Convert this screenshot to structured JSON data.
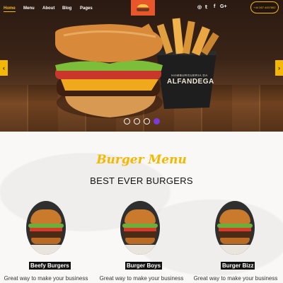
{
  "nav": {
    "items": [
      {
        "label": "Home",
        "active": true
      },
      {
        "label": "Menu",
        "active": false
      },
      {
        "label": "About",
        "active": false
      },
      {
        "label": "Blog",
        "active": false
      },
      {
        "label": "Pages",
        "active": false
      }
    ],
    "social": [
      "instagram-icon",
      "twitter-icon",
      "facebook-icon",
      "google-plus-icon"
    ],
    "social_glyphs": [
      "◎",
      "𝕥",
      "f",
      "G+"
    ],
    "phone": "+44 067 4457882"
  },
  "hero": {
    "cup_text": "HAMBURGUERIA DA",
    "cup_brand": "ALFANDEGA",
    "prev_glyph": "‹",
    "next_glyph": "›",
    "slide_count": 4,
    "active_slide": 4
  },
  "menu": {
    "script_title": "Burger Menu",
    "title": "BEST EVER BURGERS",
    "cards": [
      {
        "title": "Beefy Burgers",
        "text": "Great way to make your business"
      },
      {
        "title": "Burger Boys",
        "text": "Great way to make your business"
      },
      {
        "title": "Burger Bizz",
        "text": "Great way to make your business"
      }
    ]
  },
  "colors": {
    "accent": "#f5b800",
    "logo_bg": "#e8562a",
    "active_dot": "#7b3bd9"
  }
}
